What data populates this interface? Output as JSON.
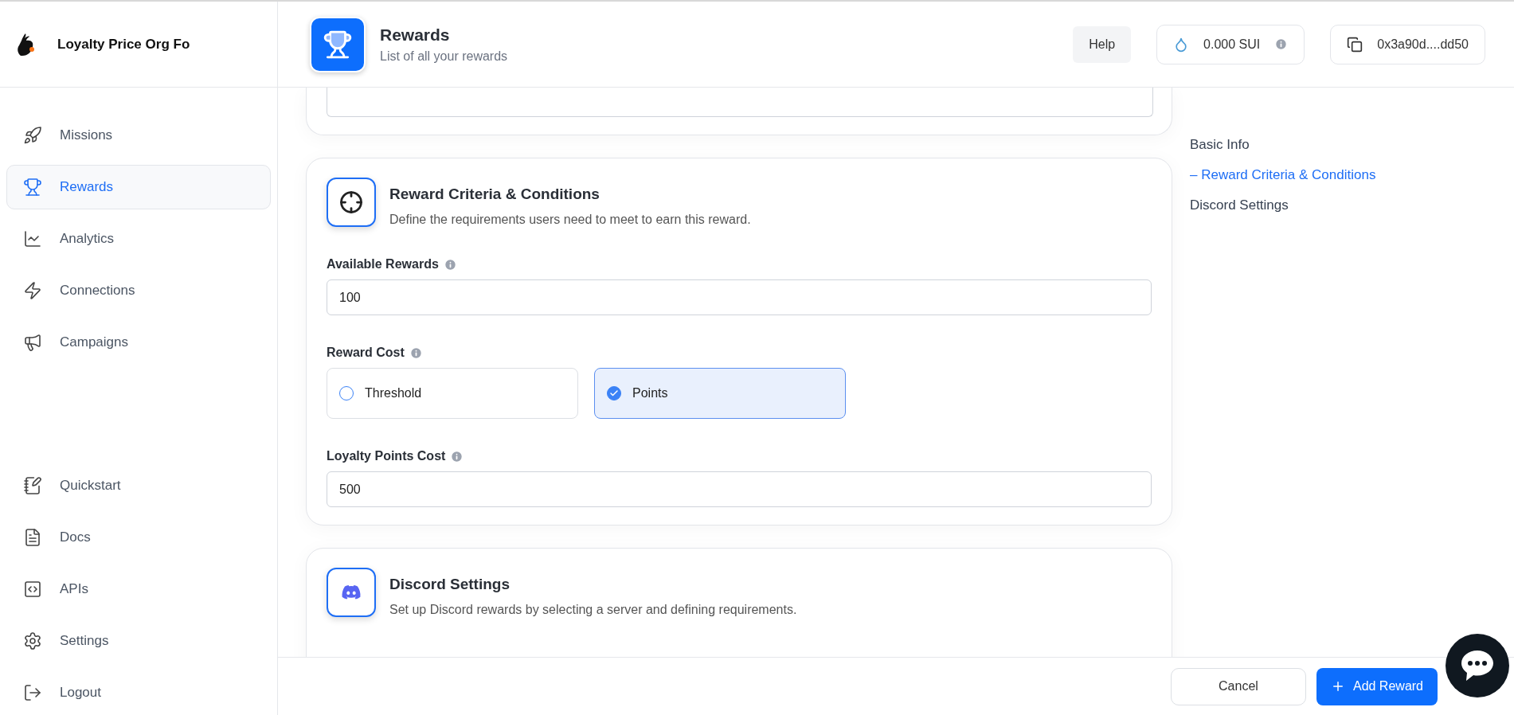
{
  "sidebar": {
    "org_name": "Loyalty Price Org Fo",
    "items": [
      {
        "label": "Missions",
        "selected": false
      },
      {
        "label": "Rewards",
        "selected": true
      },
      {
        "label": "Analytics",
        "selected": false
      },
      {
        "label": "Connections",
        "selected": false
      },
      {
        "label": "Campaigns",
        "selected": false
      }
    ],
    "bottom_items": [
      {
        "label": "Quickstart"
      },
      {
        "label": "Docs"
      },
      {
        "label": "APIs"
      },
      {
        "label": "Settings"
      },
      {
        "label": "Logout"
      }
    ]
  },
  "header": {
    "title": "Rewards",
    "subtitle": "List of all your rewards",
    "help": "Help",
    "balance": "0.000 SUI",
    "address": "0x3a90d....dd50"
  },
  "criteria_card": {
    "title": "Reward Criteria & Conditions",
    "description": "Define the requirements users need to meet to earn this reward.",
    "available_rewards": {
      "label": "Available Rewards",
      "value": "100"
    },
    "reward_cost": {
      "label": "Reward Cost",
      "options": [
        {
          "label": "Threshold",
          "selected": false
        },
        {
          "label": "Points",
          "selected": true
        }
      ]
    },
    "points_cost": {
      "label": "Loyalty Points Cost",
      "value": "500"
    }
  },
  "discord_card": {
    "title": "Discord Settings",
    "description": "Set up Discord rewards by selecting a server and defining requirements."
  },
  "section_nav": [
    {
      "label": "Basic Info",
      "selected": false
    },
    {
      "label": "Reward Criteria & Conditions",
      "selected": true
    },
    {
      "label": "Discord Settings",
      "selected": false
    }
  ],
  "section_nav_marker": "–",
  "footer": {
    "cancel": "Cancel",
    "add": "Add Reward"
  }
}
